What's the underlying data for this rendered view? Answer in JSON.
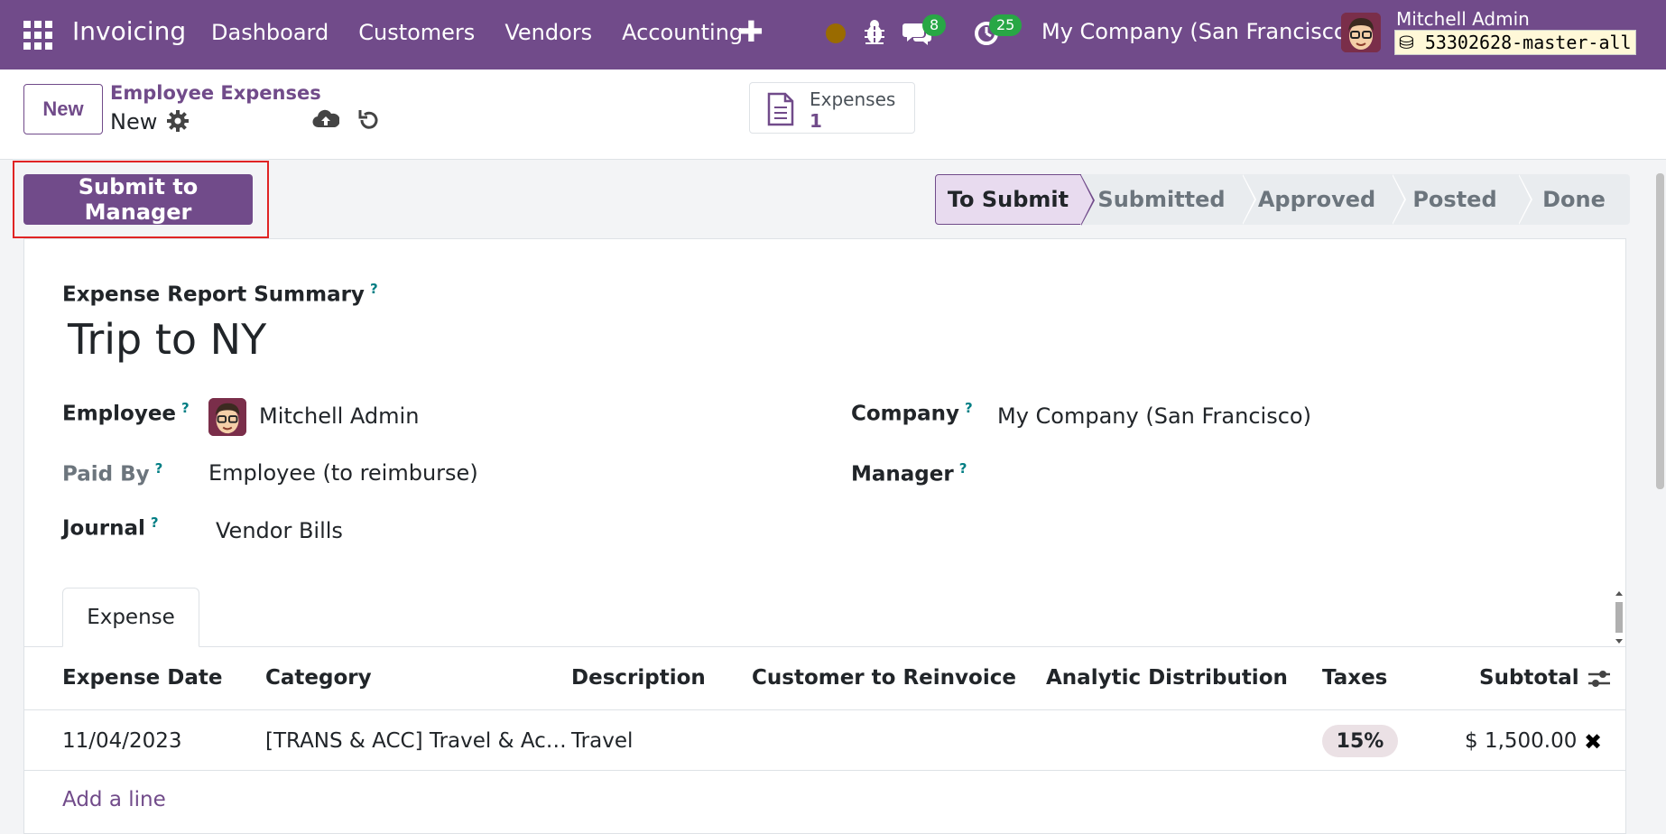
{
  "navbar": {
    "app_name": "Invoicing",
    "menu": [
      "Dashboard",
      "Customers",
      "Vendors",
      "Accounting"
    ],
    "messages_count": "8",
    "activities_count": "25",
    "company": "My Company (San Francisco)",
    "user_name": "Mitchell Admin",
    "database": "53302628-master-all"
  },
  "control_panel": {
    "new_label": "New",
    "breadcrumb": "Employee Expenses",
    "record_name": "New",
    "smart_button": {
      "label": "Expenses",
      "value": "1"
    }
  },
  "statusbar": {
    "action_label": "Submit to Manager",
    "stages": [
      "To Submit",
      "Submitted",
      "Approved",
      "Posted",
      "Done"
    ],
    "active_stage": "To Submit"
  },
  "form": {
    "summary_label": "Expense Report Summary",
    "summary_value": "Trip to NY",
    "help_mark": "?",
    "employee_label": "Employee",
    "employee_value": "Mitchell Admin",
    "paid_by_label": "Paid By",
    "paid_by_value": "Employee (to reimburse)",
    "journal_label": "Journal",
    "journal_value": "Vendor Bills",
    "company_label": "Company",
    "company_value": "My Company (San Francisco)",
    "manager_label": "Manager",
    "manager_value": ""
  },
  "tab": {
    "label": "Expense"
  },
  "table": {
    "headers": [
      "Expense Date",
      "Category",
      "Description",
      "Customer to Reinvoice",
      "Analytic Distribution",
      "Taxes",
      "Subtotal"
    ],
    "rows": [
      {
        "date": "11/04/2023",
        "category": "[TRANS & ACC] Travel & Ac…",
        "description": "Travel",
        "customer": "",
        "analytic": "",
        "taxes": "15%",
        "subtotal": "$ 1,500.00"
      }
    ],
    "add_line": "Add a line"
  },
  "colors": {
    "brand": "#714b8a",
    "highlight": "#e02424",
    "badge": "#28a745"
  }
}
